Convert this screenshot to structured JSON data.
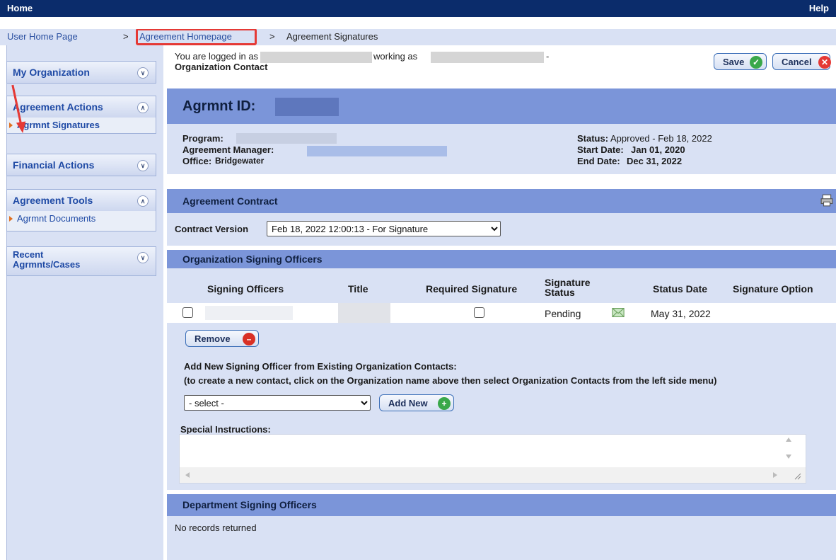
{
  "topbar": {
    "home": "Home",
    "help": "Help"
  },
  "breadcrumb": {
    "items": [
      {
        "label": "User Home Page"
      },
      {
        "label": "Agreement Homepage"
      },
      {
        "label": "Agreement Signatures"
      }
    ],
    "separator": ">"
  },
  "sidebar": {
    "groups": [
      {
        "title": "My Organization",
        "expanded": false,
        "items": []
      },
      {
        "title": "Agreement Actions",
        "expanded": true,
        "items": [
          {
            "label": "Agrmnt Signatures",
            "active": true
          }
        ]
      },
      {
        "title": "Financial Actions",
        "expanded": false,
        "items": []
      },
      {
        "title": "Agreement Tools",
        "expanded": true,
        "items": [
          {
            "label": "Agrmnt Documents",
            "active": false
          }
        ]
      },
      {
        "title_line1": "Recent",
        "title_line2": "Agrmnts/Cases",
        "expanded": false,
        "items": []
      }
    ]
  },
  "login": {
    "prefix": "You are logged in as",
    "working_as": "working as",
    "dash": "-",
    "role": "Organization Contact"
  },
  "actions": {
    "save": "Save",
    "cancel": "Cancel"
  },
  "agreement": {
    "id_label": "Agrmnt ID:",
    "program_label": "Program:",
    "manager_label": "Agreement Manager:",
    "office_label": "Office:",
    "office_value": "Bridgewater",
    "status_label": "Status:",
    "status_value": "Approved - Feb 18, 2022",
    "start_label": "Start Date:",
    "start_value": "Jan 01, 2020",
    "end_label": "End Date:",
    "end_value": "Dec 31, 2022"
  },
  "contract": {
    "header": "Agreement Contract",
    "version_label": "Contract Version",
    "version_selected": "Feb 18, 2022 12:00:13 - For Signature"
  },
  "org_signing": {
    "header": "Organization Signing Officers",
    "columns": [
      "Signing Officers",
      "Title",
      "Required Signature",
      "Signature Status",
      "Status Date",
      "Signature Option"
    ],
    "rows": [
      {
        "status": "Pending",
        "status_date": "May 31, 2022"
      }
    ],
    "remove": "Remove",
    "add_heading": "Add New Signing Officer from Existing Organization Contacts:",
    "add_hint": "(to create a new contact, click on the Organization name above then select Organization Contacts from the left side menu)",
    "select_placeholder": "- select -",
    "add_new": "Add New",
    "special_instructions": "Special Instructions:"
  },
  "dept_signing": {
    "header": "Department Signing Officers",
    "empty": "No records returned"
  },
  "colors": {
    "topbar": "#0b2c6b",
    "panel_header": "#7b95d9",
    "panel_bg": "#d9e1f4",
    "link": "#2a4fa0",
    "annotation": "#e53935"
  }
}
